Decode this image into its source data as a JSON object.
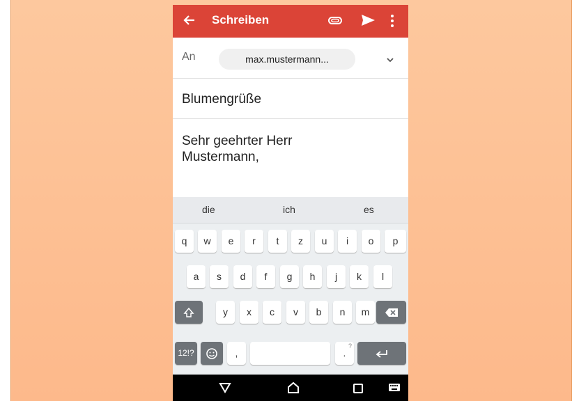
{
  "app_bar": {
    "title": "Schreiben",
    "color": "#db4437",
    "icons": [
      "arrow-back-icon",
      "paperclip-icon",
      "send-icon",
      "more-vert-icon"
    ]
  },
  "compose": {
    "to_label": "An",
    "recipient": "max.mustermann...",
    "subject": "Blumengrüße",
    "body_lines": [
      "Sehr geehrter Herr",
      "Mustermann,"
    ]
  },
  "keyboard": {
    "suggestions": [
      "die",
      "ich",
      "es"
    ],
    "row1": [
      "q",
      "w",
      "e",
      "r",
      "t",
      "z",
      "u",
      "i",
      "o",
      "p"
    ],
    "row2": [
      "a",
      "s",
      "d",
      "f",
      "g",
      "h",
      "j",
      "k",
      "l"
    ],
    "row3": [
      "y",
      "x",
      "c",
      "v",
      "b",
      "n",
      "m"
    ],
    "symbols_key": "12!?",
    "comma_key": ",",
    "period_key": ".",
    "period_hint": "?",
    "icons": [
      "shift-icon",
      "backspace-icon",
      "emoji-icon",
      "enter-icon"
    ]
  },
  "navbar": {
    "icons": [
      "back-triangle-icon",
      "home-icon",
      "recents-icon",
      "keyboard-switch-icon"
    ]
  }
}
